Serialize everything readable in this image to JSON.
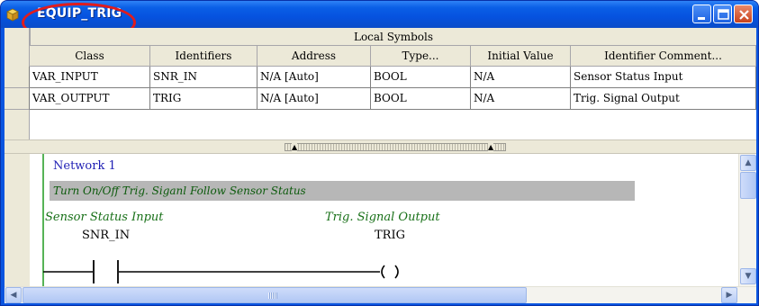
{
  "window": {
    "title": "EQUIP_TRIG",
    "icon": "program-icon",
    "controls": [
      "minimize-icon",
      "maximize-icon",
      "close-icon"
    ]
  },
  "symbols": {
    "title": "Local Symbols",
    "columns": [
      "Class",
      "Identifiers",
      "Address",
      "Type...",
      "Initial Value",
      "Identifier Comment..."
    ],
    "rows": [
      [
        "VAR_INPUT",
        "SNR_IN",
        "N/A [Auto]",
        "BOOL",
        "N/A",
        "Sensor Status Input"
      ],
      [
        "VAR_OUTPUT",
        "TRIG",
        "N/A [Auto]",
        "BOOL",
        "N/A",
        "Trig. Signal Output"
      ]
    ]
  },
  "ladder": {
    "network_label": "Network 1",
    "network_comment": "Turn On/Off Trig. Siganl Follow Sensor Status",
    "contact": {
      "comment": "Sensor Status Input",
      "name": "SNR_IN"
    },
    "coil": {
      "comment": "Trig. Signal Output",
      "name": "TRIG"
    }
  },
  "colors": {
    "title_bar": "#0a55e0",
    "highlight_ellipse": "#e21c1c",
    "comment_text": "#187018",
    "network_text": "#1f1fb4"
  }
}
